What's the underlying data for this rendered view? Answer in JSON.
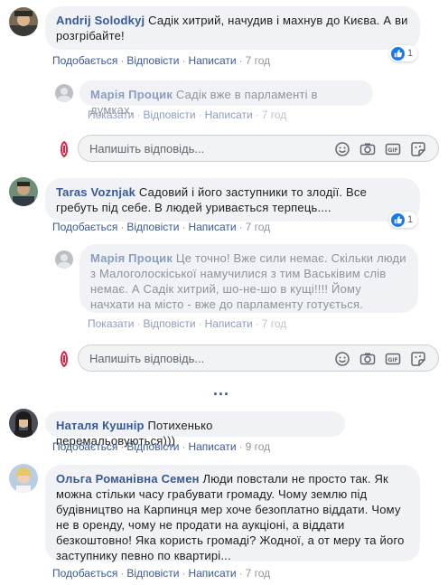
{
  "comments": [
    {
      "author": "Andrij Solodkyj",
      "text": "Садік хитрий, начудив і махнув до Києва. А ви розгрібайте!",
      "actions": [
        "Подобається",
        "Відповісти",
        "Написати"
      ],
      "time": "7 год",
      "reaction_count": "1"
    },
    {
      "author": "Марія Процик",
      "text": "Садік вже в парламенті в думках.",
      "actions": [
        "Показати",
        "Відповісти",
        "Написати"
      ],
      "time": "7 год"
    },
    {
      "author": "Taras Voznjak",
      "text": "Садовий і його заступники то злодії. Все гребуть під себе. В людей уривається терпець....",
      "actions": [
        "Подобається",
        "Відповісти",
        "Написати"
      ],
      "time": "7 год",
      "reaction_count": "1"
    },
    {
      "author": "Марія Процик",
      "text": "Це точно! Вже сили немає. Скільки люди з Малоголоскіської намучилися з тим Васьківим слів немає. А Садік хитрий, шо-не-шо в кущі!!!! Йому начхати на місто - вже до парламенту готується.",
      "actions": [
        "Показати",
        "Відповісти",
        "Написати"
      ],
      "time": "7 год"
    },
    {
      "author": "Наталя Кушнір",
      "text": "Потихенько перемальовуються)))",
      "actions": [
        "Подобається",
        "Відповісти",
        "Написати"
      ],
      "time": "9 год"
    },
    {
      "author": "Ольга Романівна Семен",
      "text": "Люди повстали не просто так. Як можна стільки часу грабувати громаду. Чому землю під будівництво на Карпинця мер хоче безоплатно віддати. Чому не в оренду, чому не продати на аукціоні, а віддати безкоштовно! Яка користь громаді? Жодної, а от меру та його заступнику певно по квартирі...",
      "actions": [
        "Подобається",
        "Відповісти",
        "Написати"
      ],
      "time": "7 год"
    }
  ],
  "reply_box": {
    "placeholder": "Напишіть відповідь..."
  },
  "more_indicator": "...",
  "colors": {
    "link": "#385898",
    "bubble": "#f0f2f5",
    "like_blue": "#1877f2"
  }
}
